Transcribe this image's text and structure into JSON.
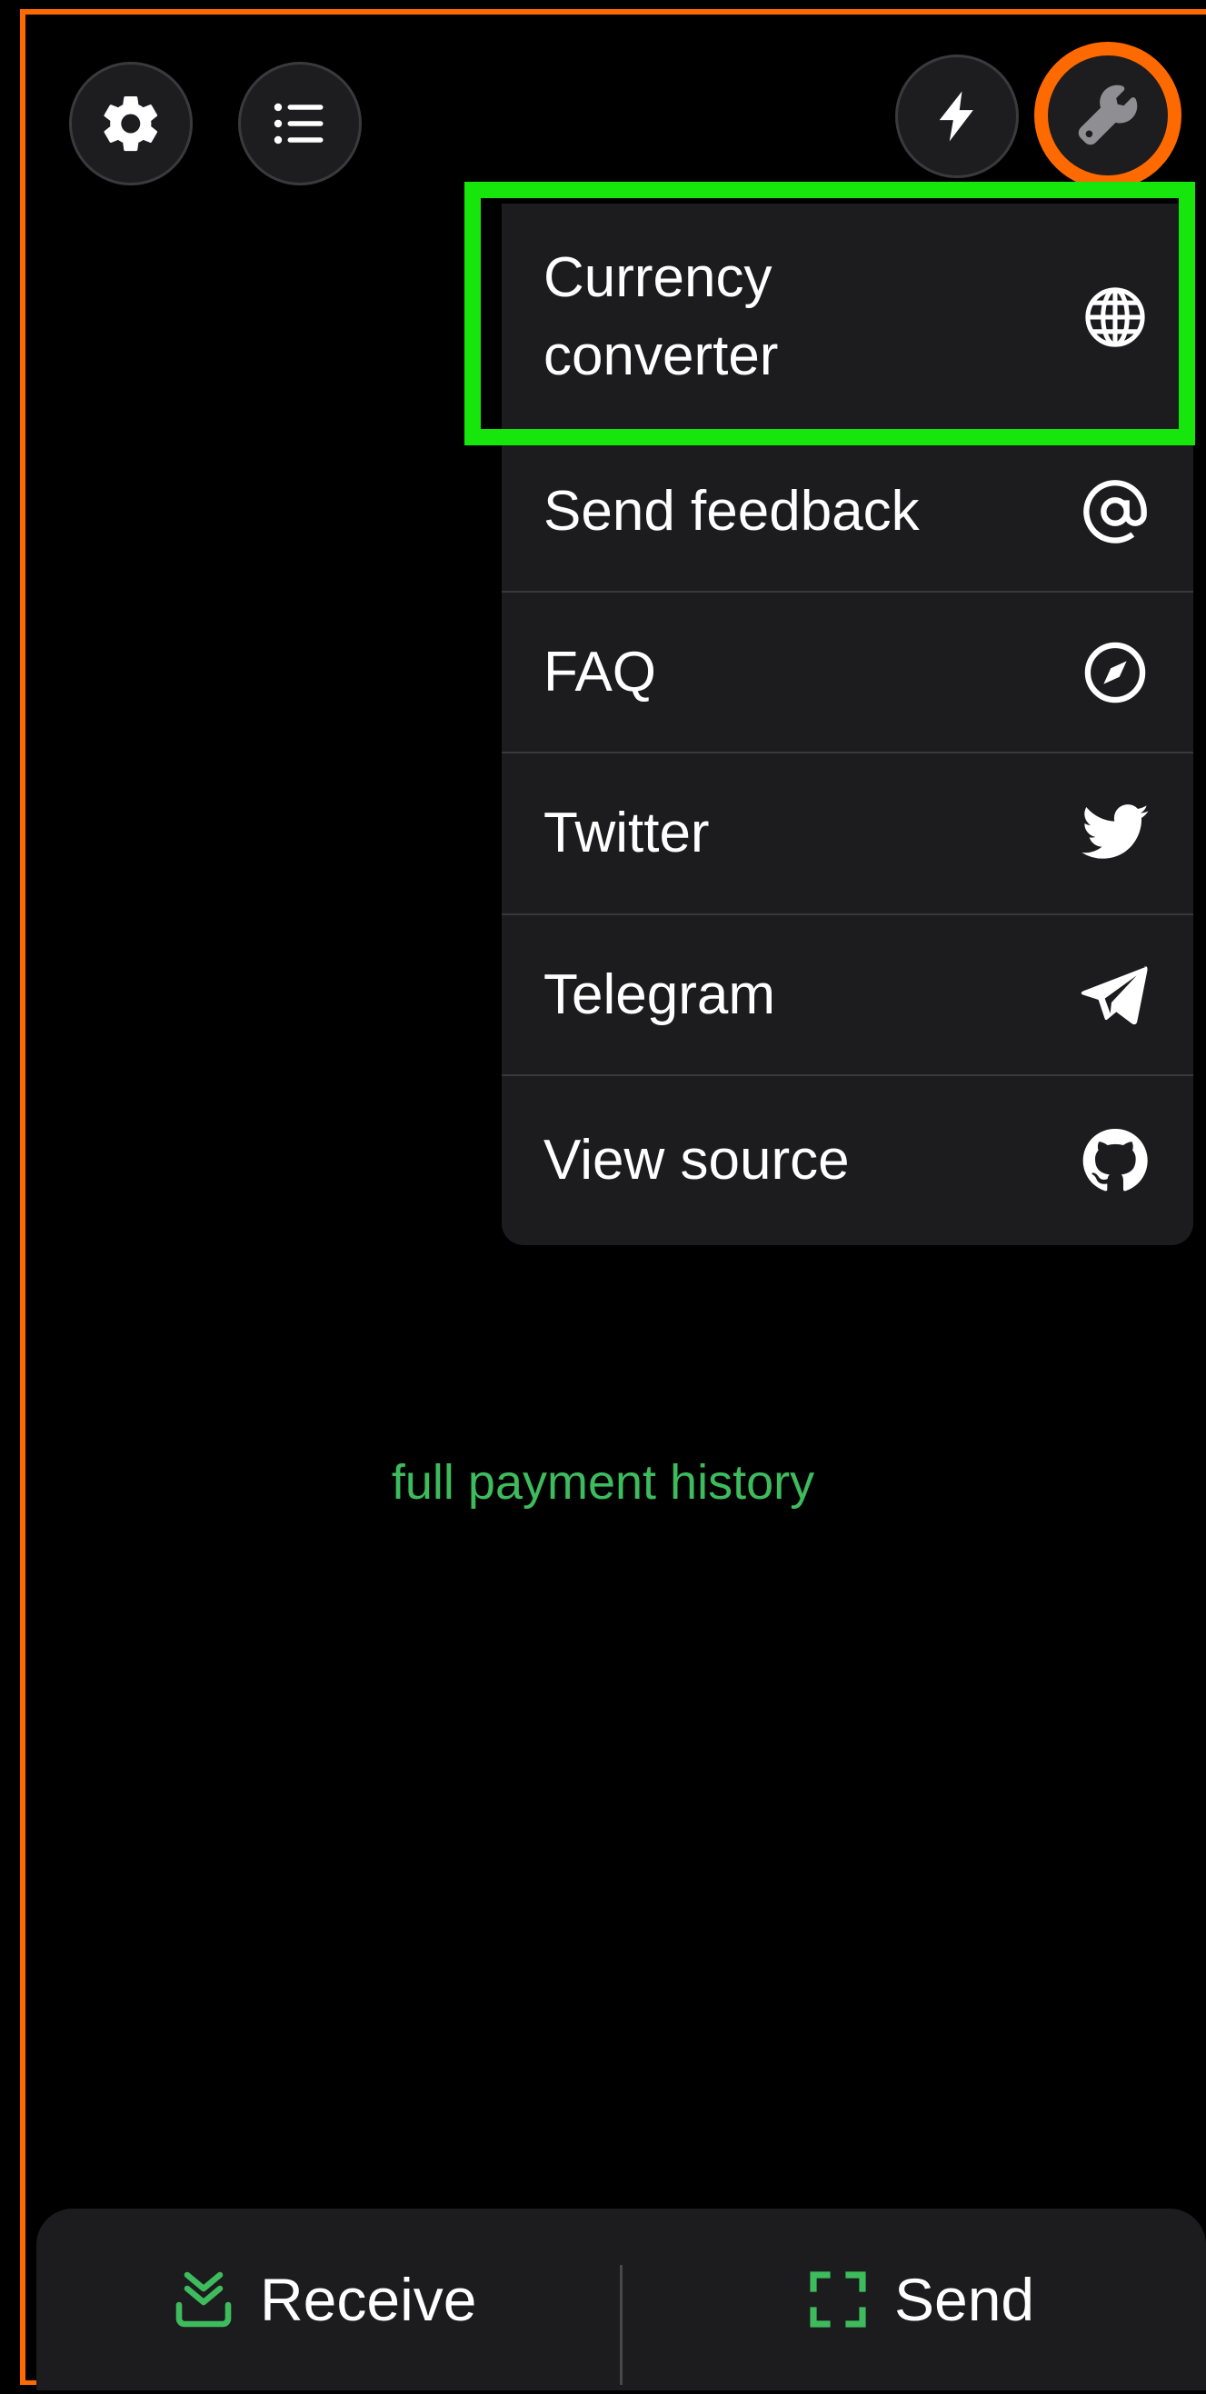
{
  "header": {
    "settings_icon": "gear-icon",
    "list_icon": "list-icon",
    "lightning_icon": "lightning-icon",
    "tools_icon": "wrench-icon"
  },
  "menu": {
    "items": [
      {
        "label": "Currency\nconverter",
        "icon": "globe-icon"
      },
      {
        "label": "Send feedback",
        "icon": "at-icon"
      },
      {
        "label": "FAQ",
        "icon": "compass-icon"
      },
      {
        "label": "Twitter",
        "icon": "twitter-icon"
      },
      {
        "label": "Telegram",
        "icon": "telegram-icon"
      },
      {
        "label": "View source",
        "icon": "github-icon"
      }
    ]
  },
  "main": {
    "history_link": "full payment history"
  },
  "bottom_bar": {
    "receive_label": "Receive",
    "send_label": "Send"
  },
  "colors": {
    "accent_green": "#3dbb5d",
    "annotation_orange": "#ff6a00",
    "annotation_green": "#16e60c",
    "menu_bg": "#1c1c1e"
  }
}
